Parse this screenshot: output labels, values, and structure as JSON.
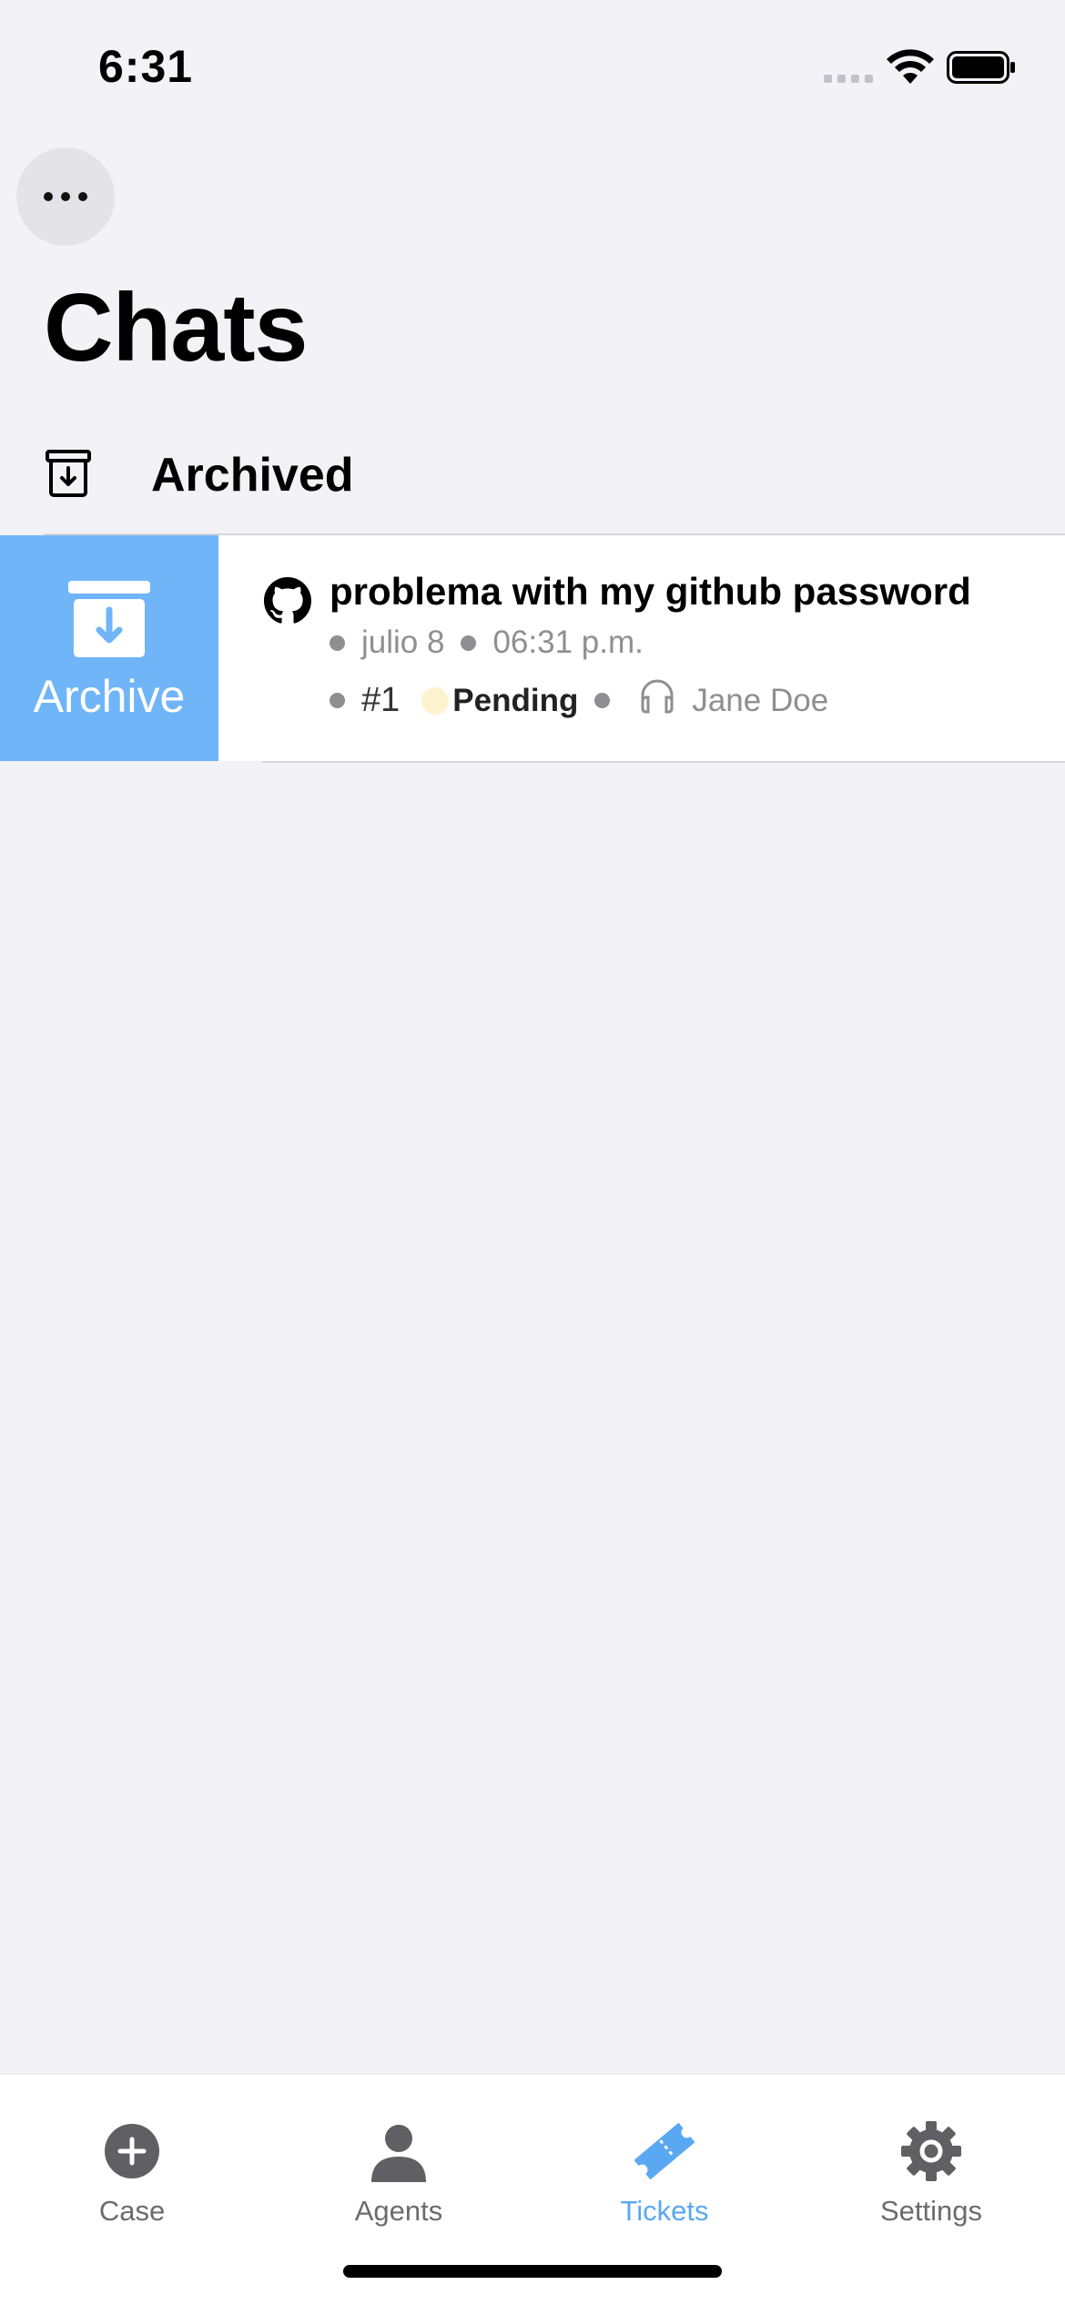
{
  "status_bar": {
    "time": "6:31"
  },
  "header": {
    "title": "Chats"
  },
  "archived": {
    "label": "Archived"
  },
  "chat": {
    "swipe_action_label": "Archive",
    "title": "problema with my github password",
    "date": "julio 8",
    "time": "06:31 p.m.",
    "ticket_number": "#1",
    "status": "Pending",
    "agent": "Jane Doe"
  },
  "tabs": [
    {
      "label": "Case",
      "icon": "plus-circle-icon"
    },
    {
      "label": "Agents",
      "icon": "person-icon"
    },
    {
      "label": "Tickets",
      "icon": "ticket-icon",
      "active": true
    },
    {
      "label": "Settings",
      "icon": "gear-icon"
    }
  ],
  "colors": {
    "accent": "#5aa8f2",
    "archive_bg": "#6fb5f8",
    "pending": "#fdf3d0"
  }
}
